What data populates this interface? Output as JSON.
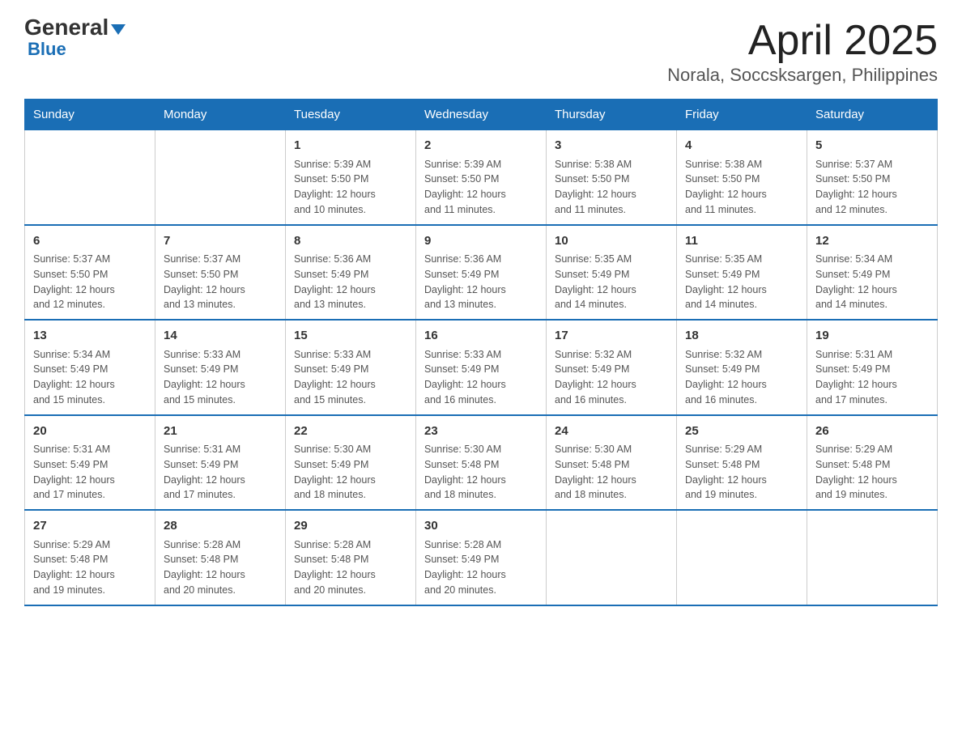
{
  "logo": {
    "general": "General",
    "arrow": "▼",
    "blue": "Blue"
  },
  "header": {
    "month_year": "April 2025",
    "location": "Norala, Soccsksargen, Philippines"
  },
  "weekdays": [
    "Sunday",
    "Monday",
    "Tuesday",
    "Wednesday",
    "Thursday",
    "Friday",
    "Saturday"
  ],
  "weeks": [
    [
      {
        "day": "",
        "info": ""
      },
      {
        "day": "",
        "info": ""
      },
      {
        "day": "1",
        "info": "Sunrise: 5:39 AM\nSunset: 5:50 PM\nDaylight: 12 hours\nand 10 minutes."
      },
      {
        "day": "2",
        "info": "Sunrise: 5:39 AM\nSunset: 5:50 PM\nDaylight: 12 hours\nand 11 minutes."
      },
      {
        "day": "3",
        "info": "Sunrise: 5:38 AM\nSunset: 5:50 PM\nDaylight: 12 hours\nand 11 minutes."
      },
      {
        "day": "4",
        "info": "Sunrise: 5:38 AM\nSunset: 5:50 PM\nDaylight: 12 hours\nand 11 minutes."
      },
      {
        "day": "5",
        "info": "Sunrise: 5:37 AM\nSunset: 5:50 PM\nDaylight: 12 hours\nand 12 minutes."
      }
    ],
    [
      {
        "day": "6",
        "info": "Sunrise: 5:37 AM\nSunset: 5:50 PM\nDaylight: 12 hours\nand 12 minutes."
      },
      {
        "day": "7",
        "info": "Sunrise: 5:37 AM\nSunset: 5:50 PM\nDaylight: 12 hours\nand 13 minutes."
      },
      {
        "day": "8",
        "info": "Sunrise: 5:36 AM\nSunset: 5:49 PM\nDaylight: 12 hours\nand 13 minutes."
      },
      {
        "day": "9",
        "info": "Sunrise: 5:36 AM\nSunset: 5:49 PM\nDaylight: 12 hours\nand 13 minutes."
      },
      {
        "day": "10",
        "info": "Sunrise: 5:35 AM\nSunset: 5:49 PM\nDaylight: 12 hours\nand 14 minutes."
      },
      {
        "day": "11",
        "info": "Sunrise: 5:35 AM\nSunset: 5:49 PM\nDaylight: 12 hours\nand 14 minutes."
      },
      {
        "day": "12",
        "info": "Sunrise: 5:34 AM\nSunset: 5:49 PM\nDaylight: 12 hours\nand 14 minutes."
      }
    ],
    [
      {
        "day": "13",
        "info": "Sunrise: 5:34 AM\nSunset: 5:49 PM\nDaylight: 12 hours\nand 15 minutes."
      },
      {
        "day": "14",
        "info": "Sunrise: 5:33 AM\nSunset: 5:49 PM\nDaylight: 12 hours\nand 15 minutes."
      },
      {
        "day": "15",
        "info": "Sunrise: 5:33 AM\nSunset: 5:49 PM\nDaylight: 12 hours\nand 15 minutes."
      },
      {
        "day": "16",
        "info": "Sunrise: 5:33 AM\nSunset: 5:49 PM\nDaylight: 12 hours\nand 16 minutes."
      },
      {
        "day": "17",
        "info": "Sunrise: 5:32 AM\nSunset: 5:49 PM\nDaylight: 12 hours\nand 16 minutes."
      },
      {
        "day": "18",
        "info": "Sunrise: 5:32 AM\nSunset: 5:49 PM\nDaylight: 12 hours\nand 16 minutes."
      },
      {
        "day": "19",
        "info": "Sunrise: 5:31 AM\nSunset: 5:49 PM\nDaylight: 12 hours\nand 17 minutes."
      }
    ],
    [
      {
        "day": "20",
        "info": "Sunrise: 5:31 AM\nSunset: 5:49 PM\nDaylight: 12 hours\nand 17 minutes."
      },
      {
        "day": "21",
        "info": "Sunrise: 5:31 AM\nSunset: 5:49 PM\nDaylight: 12 hours\nand 17 minutes."
      },
      {
        "day": "22",
        "info": "Sunrise: 5:30 AM\nSunset: 5:49 PM\nDaylight: 12 hours\nand 18 minutes."
      },
      {
        "day": "23",
        "info": "Sunrise: 5:30 AM\nSunset: 5:48 PM\nDaylight: 12 hours\nand 18 minutes."
      },
      {
        "day": "24",
        "info": "Sunrise: 5:30 AM\nSunset: 5:48 PM\nDaylight: 12 hours\nand 18 minutes."
      },
      {
        "day": "25",
        "info": "Sunrise: 5:29 AM\nSunset: 5:48 PM\nDaylight: 12 hours\nand 19 minutes."
      },
      {
        "day": "26",
        "info": "Sunrise: 5:29 AM\nSunset: 5:48 PM\nDaylight: 12 hours\nand 19 minutes."
      }
    ],
    [
      {
        "day": "27",
        "info": "Sunrise: 5:29 AM\nSunset: 5:48 PM\nDaylight: 12 hours\nand 19 minutes."
      },
      {
        "day": "28",
        "info": "Sunrise: 5:28 AM\nSunset: 5:48 PM\nDaylight: 12 hours\nand 20 minutes."
      },
      {
        "day": "29",
        "info": "Sunrise: 5:28 AM\nSunset: 5:48 PM\nDaylight: 12 hours\nand 20 minutes."
      },
      {
        "day": "30",
        "info": "Sunrise: 5:28 AM\nSunset: 5:49 PM\nDaylight: 12 hours\nand 20 minutes."
      },
      {
        "day": "",
        "info": ""
      },
      {
        "day": "",
        "info": ""
      },
      {
        "day": "",
        "info": ""
      }
    ]
  ]
}
